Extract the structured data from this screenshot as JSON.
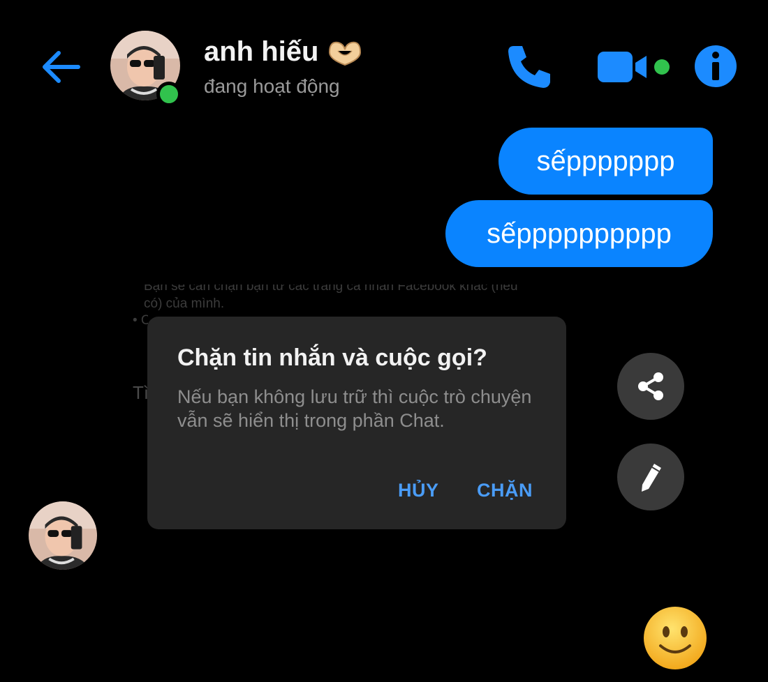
{
  "header": {
    "contact_name": "anh hiếu",
    "status": "đang hoạt động",
    "icons": [
      "back-arrow-icon",
      "heart-hands-emoji-icon",
      "phone-icon",
      "video-camera-icon",
      "info-icon"
    ]
  },
  "messages": [
    {
      "text": "sếppppppp",
      "sender": "me"
    },
    {
      "text": "sếpppppppppp",
      "sender": "me"
    }
  ],
  "background_text": {
    "line_partial": "Bạn sẽ cần chặn bạn từ các trang cá nhân Facebook khác (nếu",
    "line_2": "có) của mình.",
    "line_3": "• C",
    "line_4": "Tì"
  },
  "dialog": {
    "title": "Chặn tin nhắn và cuộc gọi?",
    "body": "Nếu bạn không lưu trữ thì cuộc trò chuyện vẫn sẽ hiển thị trong phần Chat.",
    "cancel_label": "HỦY",
    "block_label": "CHẶN"
  },
  "fabs": [
    "share-icon",
    "pencil-icon"
  ],
  "colors": {
    "accent": "#0a84ff",
    "online": "#31c24d",
    "dialog_bg": "#262626",
    "dialog_button": "#4a9cf6",
    "fab_bg": "#3a3a3a"
  }
}
